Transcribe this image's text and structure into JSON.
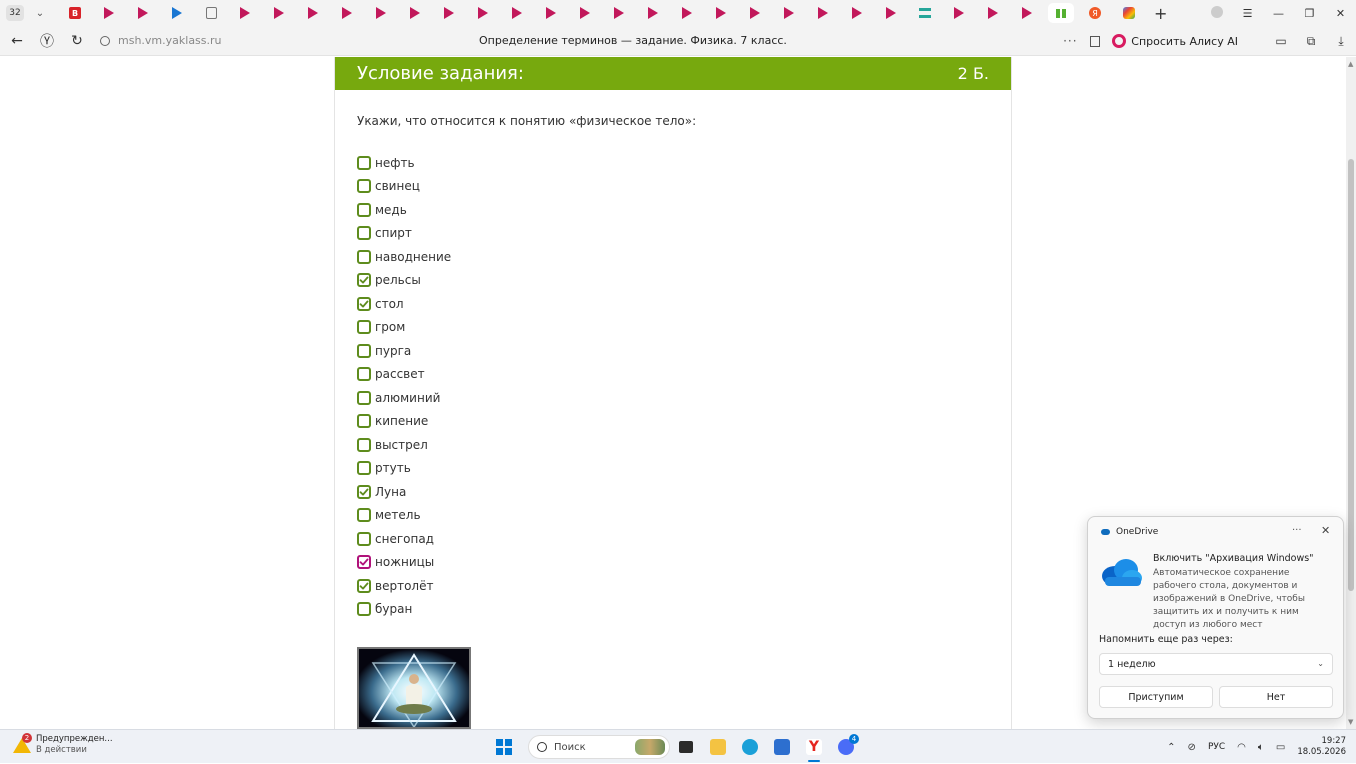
{
  "browser": {
    "tab_count": "32",
    "address": "msh.vm.yaklass.ru",
    "page_title": "Определение терминов — задание. Физика. 7 класс.",
    "alice_button": "Спросить Алису AI"
  },
  "task": {
    "header_title": "Условие задания:",
    "points": "2 Б.",
    "question": "Укажи, что относится к понятию «физическое тело»:",
    "options": [
      {
        "label": "нефть",
        "checked": false
      },
      {
        "label": "свинец",
        "checked": false
      },
      {
        "label": "медь",
        "checked": false
      },
      {
        "label": "спирт",
        "checked": false
      },
      {
        "label": "наводнение",
        "checked": false
      },
      {
        "label": "рельсы",
        "checked": true
      },
      {
        "label": "стол",
        "checked": true
      },
      {
        "label": "гром",
        "checked": false
      },
      {
        "label": "пурга",
        "checked": false
      },
      {
        "label": "рассвет",
        "checked": false
      },
      {
        "label": "алюминий",
        "checked": false
      },
      {
        "label": "кипение",
        "checked": false
      },
      {
        "label": "выстрел",
        "checked": false
      },
      {
        "label": "ртуть",
        "checked": false
      },
      {
        "label": "Луна",
        "checked": true
      },
      {
        "label": "метель",
        "checked": false
      },
      {
        "label": "снегопад",
        "checked": false
      },
      {
        "label": "ножницы",
        "checked": true,
        "highlight": "pink"
      },
      {
        "label": "вертолёт",
        "checked": true
      },
      {
        "label": "буран",
        "checked": false
      }
    ]
  },
  "toast": {
    "app_name": "OneDrive",
    "title": "Включить \"Архивация Windows\"",
    "body": "Автоматическое сохранение рабочего стола, документов и изображений в OneDrive, чтобы защитить их и получить к ним доступ из любого мест",
    "remind_label": "Напомнить еще раз через:",
    "remind_value": "1 неделю",
    "accept_button": "Приступим",
    "decline_button": "Нет"
  },
  "taskbar": {
    "warning_badge": "2",
    "warning_title": "Предупрежден...",
    "warning_sub": "В действии",
    "search_placeholder": "Поиск",
    "app_badge": "4",
    "lang": "РУС",
    "time": "19:27",
    "date": "18.05.2026"
  },
  "colors": {
    "header_green": "#77a90e",
    "checkbox_green": "#5e8c1d",
    "checkbox_pink": "#b0127a"
  }
}
